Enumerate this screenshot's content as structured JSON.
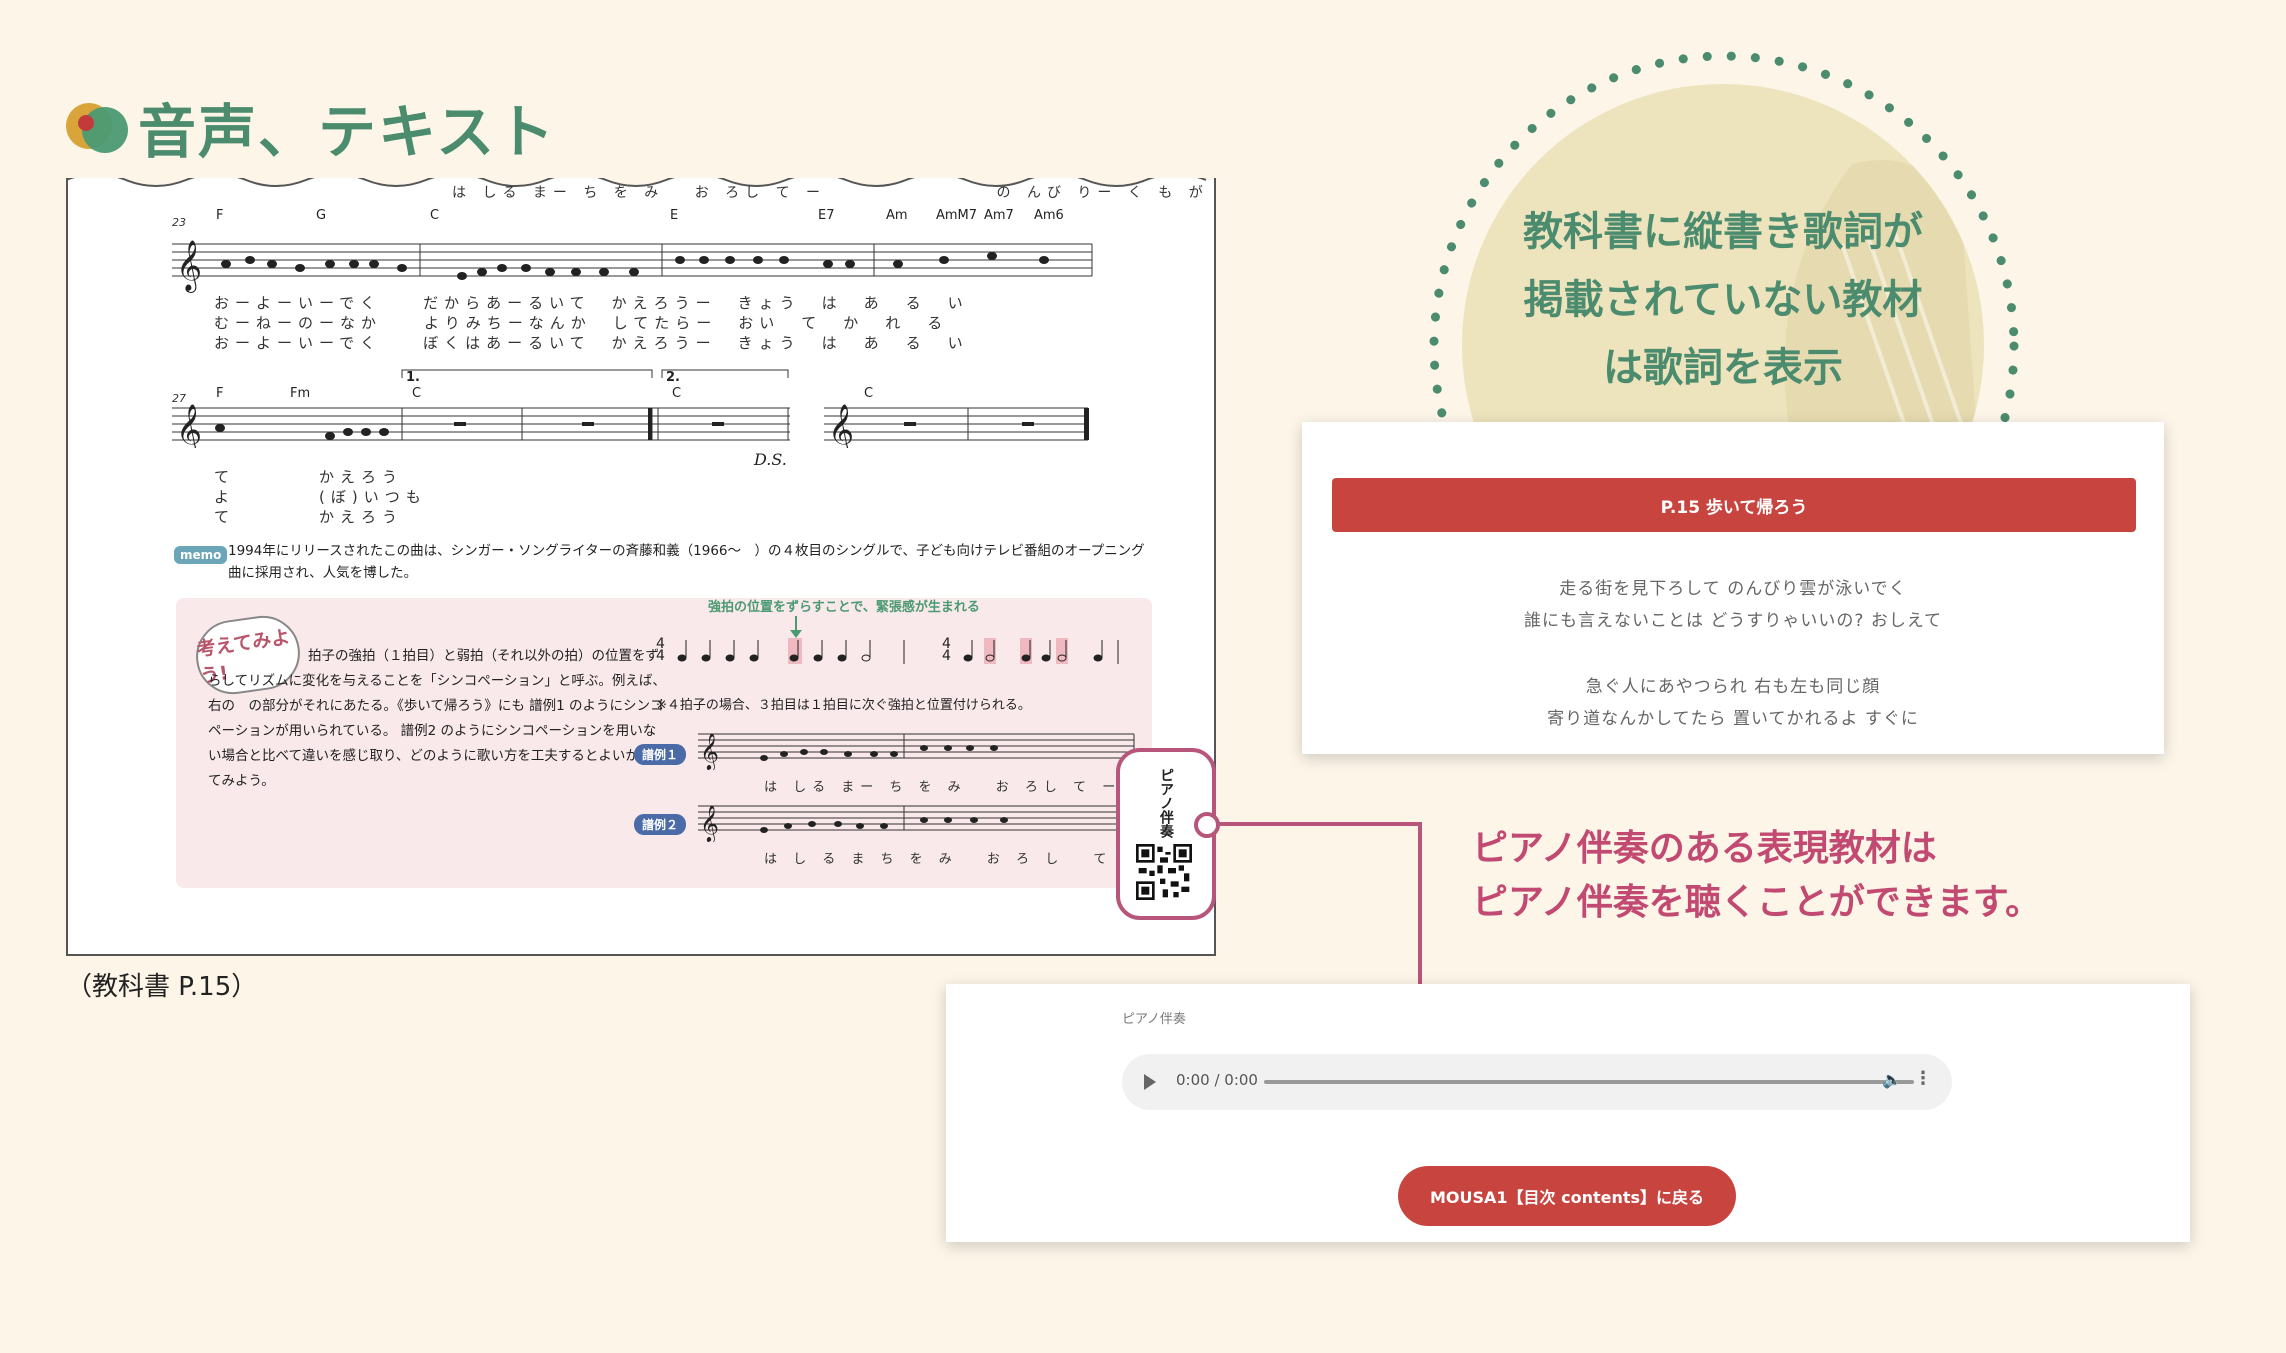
{
  "page": {
    "title": "音声、テキスト",
    "textbook_caption": "（教科書 P.15）"
  },
  "textbook": {
    "top_lyrics": "は しる まー ち を み　 お ろし て ー　　　　　　　　 の んび りー く も が",
    "row1": {
      "bar_number": "23",
      "chords": [
        "F",
        "G",
        "C",
        "E",
        "E7",
        "Am",
        "AmM7",
        "Am7",
        "Am6"
      ],
      "lyrics": [
        "おーよーいーでく　　だからあーるいて　かえろうー　きょう　は　あ　る　い",
        "むーねーのーなか　　よりみちーなんか　してたらー　おい　て　か　れ　る",
        "おーよーいーでく　　ぼくはあーるいて　かえろうー　きょう　は　あ　る　い"
      ]
    },
    "row2": {
      "bar_number": "27",
      "chords": [
        "F",
        "Fm",
        "C",
        "C",
        "C"
      ],
      "volta1": "1.",
      "volta2": "2.",
      "ds": "D.S.",
      "lyrics": [
        "て　　　　かえろう",
        "よ　　　　(ぼ)いつも",
        "て　　　　かえろう"
      ]
    },
    "memo_label": "memo",
    "memo_text": "1994年にリリースされたこの曲は、シンガー・ソングライターの斉藤和義（1966〜　）の４枚目のシングルで、子ども向けテレビ番組のオープニング曲に採用され、人気を博した。",
    "think_badge": "考えてみよう!",
    "think_text": "拍子の強拍（１拍目）と弱拍（それ以外の拍）の位置をずらしてリズムに変化を与えることを「シンコペーション」と呼ぶ。例えば、右の　の部分がそれにあたる。《歩いて帰ろう》にも 譜例1 のようにシンコペーションが用いられている。 譜例2 のようにシンコペーションを用いない場合と比べて違いを感じ取り、どのように歌い方を工夫するとよいか考えてみよう。",
    "accent_note": "強拍の位置をずらすことで、緊張感が生まれる",
    "beat_note": "※４拍子の場合、３拍目は１拍目に次ぐ強拍と位置付けられる。",
    "example1": {
      "label": "譜例１",
      "lyrics": "は しる まー ち を み　 お ろし て ー"
    },
    "example2": {
      "label": "譜例２",
      "lyrics": "は し る ま ち を み　 お ろ し　 て"
    },
    "qr_label": "ピアノ伴奏"
  },
  "callout_lyrics": {
    "lines": [
      "教科書に縦書き歌詞が",
      "掲載されていない教材",
      "は歌詞を表示"
    ]
  },
  "lyrics_card": {
    "header": "P.15 歩いて帰ろう",
    "lines": [
      "走る街を見下ろして のんびり雲が泳いでく",
      "誰にも言えないことは どうすりゃいいの? おしえて",
      "急ぐ人にあやつられ 右も左も同じ顔",
      "寄り道なんかしてたら 置いてかれるよ すぐに"
    ]
  },
  "piano_callout": {
    "lines": [
      "ピアノ伴奏のある表現教材は",
      "ピアノ伴奏を聴くことができます。"
    ]
  },
  "audio_card": {
    "label": "ピアノ伴奏",
    "time": "0:00 / 0:00",
    "back_button": "MOUSA1【目次 contents】に戻る"
  },
  "colors": {
    "background": "#fcf5e8",
    "title_green": "#4b8b6e",
    "accent_red": "#c8453f",
    "accent_pink": "#c24a72",
    "circle_fill": "#ede3bd"
  }
}
